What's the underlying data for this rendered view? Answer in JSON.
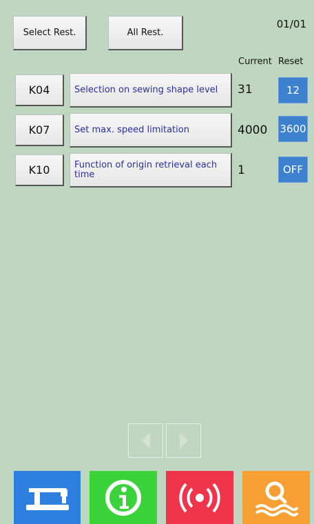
{
  "toolbar": {
    "select_rest_label": "Select Rest.",
    "all_rest_label": "All Rest."
  },
  "page_indicator": "01/01",
  "columns": {
    "current": "Current",
    "reset": "Reset"
  },
  "rows": [
    {
      "code": "K04",
      "description": "Selection on sewing shape level",
      "current": "31",
      "reset": "12"
    },
    {
      "code": "K07",
      "description": "Set max. speed limitation",
      "current": "4000",
      "reset": "3600"
    },
    {
      "code": "K10",
      "description": "Function of origin retrieval each time",
      "current": "1",
      "reset": "OFF"
    }
  ],
  "pagination": {
    "prev_icon": "chevron-left-icon",
    "next_icon": "chevron-right-icon"
  },
  "bottom_bar": [
    {
      "name": "sewing-machine-icon",
      "color": "#2f7fe0"
    },
    {
      "name": "info-icon",
      "color": "#3bd23b"
    },
    {
      "name": "signal-icon",
      "color": "#f0344c"
    },
    {
      "name": "search-icon",
      "color": "#f6a033"
    }
  ],
  "colors": {
    "background": "#bfd6c0",
    "reset_box": "#3d80cd",
    "description_text": "#2a2fa0"
  }
}
